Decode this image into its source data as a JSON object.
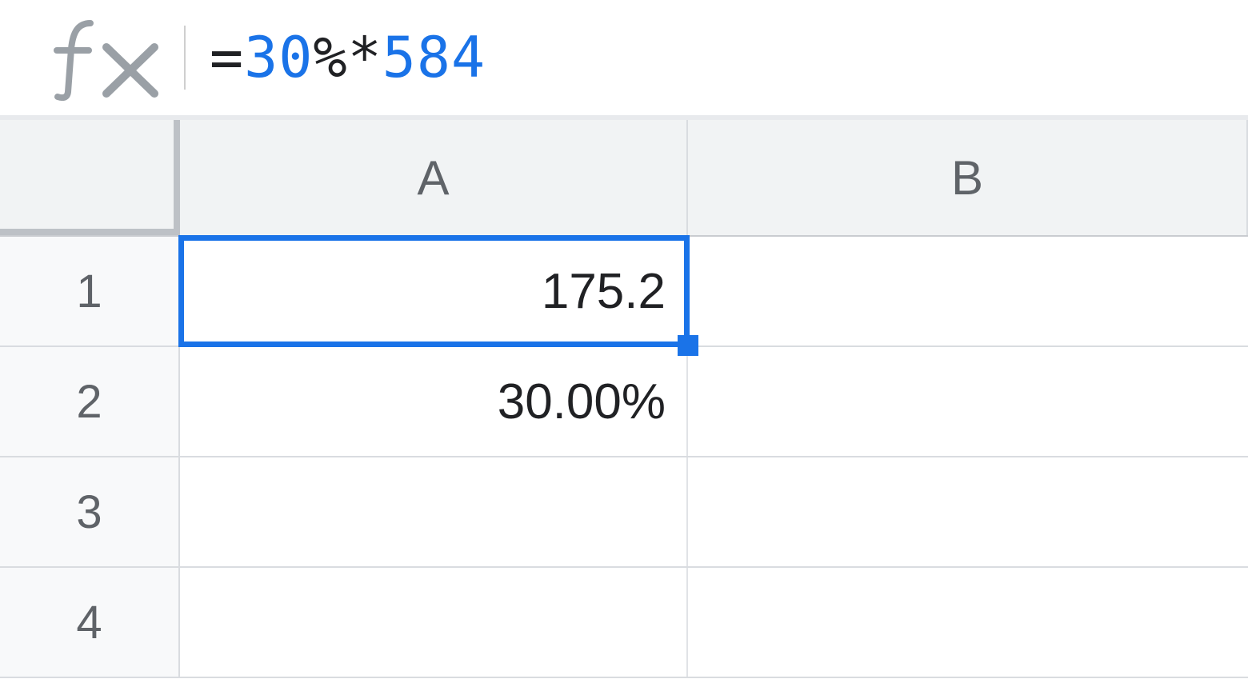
{
  "formula_bar": {
    "tokens": [
      {
        "text": "=",
        "cls": "tok-black"
      },
      {
        "text": "30",
        "cls": "tok-blue"
      },
      {
        "text": "%*",
        "cls": "tok-black"
      },
      {
        "text": "584",
        "cls": "tok-blue"
      }
    ]
  },
  "columns": [
    "A",
    "B"
  ],
  "rows": [
    {
      "num": "1",
      "A": "175.2",
      "B": ""
    },
    {
      "num": "2",
      "A": "30.00%",
      "B": ""
    },
    {
      "num": "3",
      "A": "",
      "B": ""
    },
    {
      "num": "4",
      "A": "",
      "B": ""
    }
  ],
  "selection": {
    "cell": "A1"
  }
}
